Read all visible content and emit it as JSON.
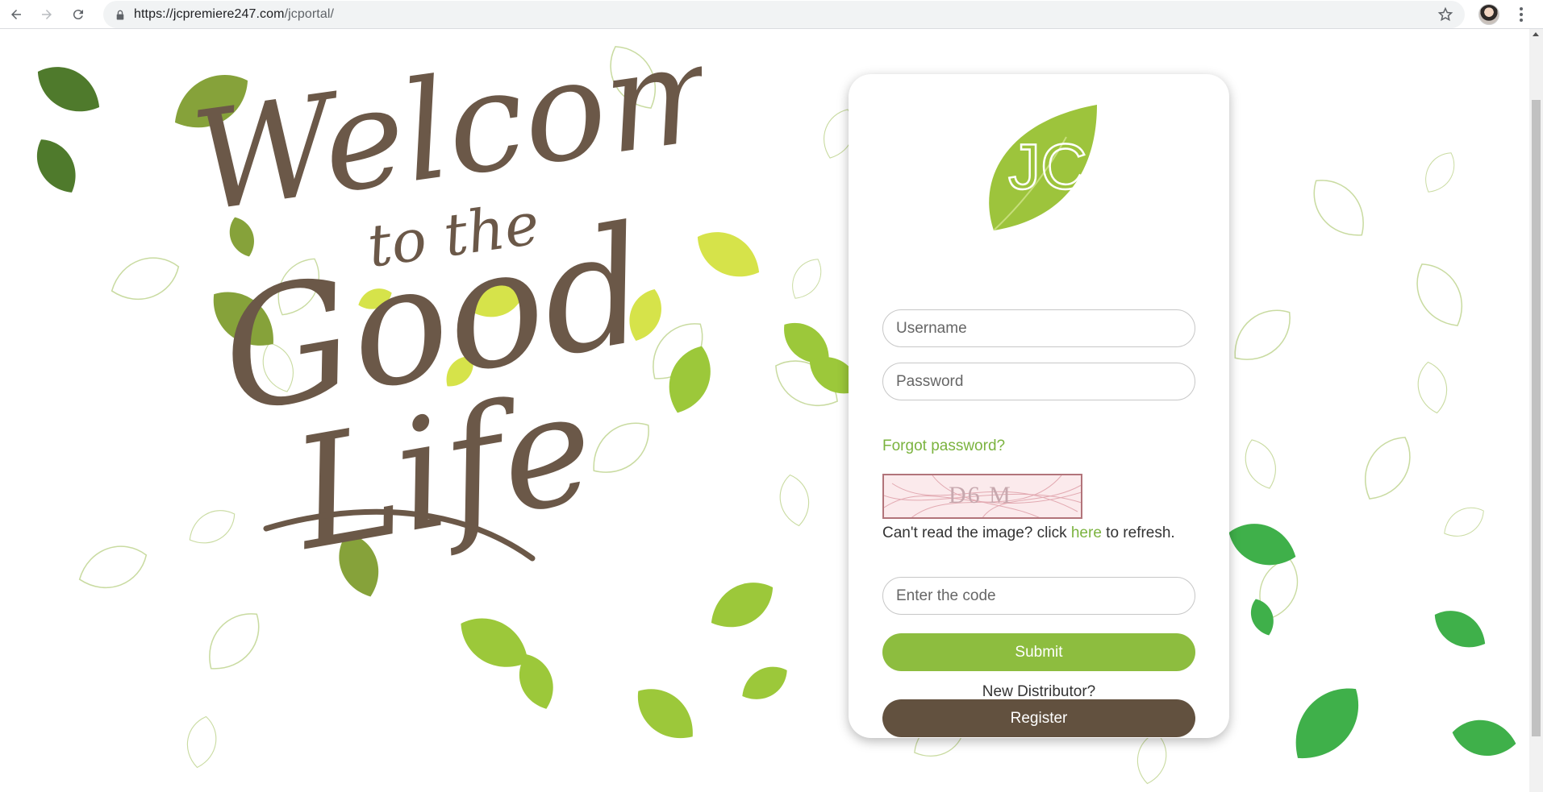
{
  "browser": {
    "url_host": "https://jcpremiere247.com",
    "url_path": "/jcportal/"
  },
  "hero": {
    "line1": "Welcome",
    "line2": "to the",
    "line3": "Good",
    "line4": "Life"
  },
  "login": {
    "logo_text": "JC",
    "username_placeholder": "Username",
    "password_placeholder": "Password",
    "forgot_label": "Forgot password?",
    "captcha_text": "D6 M",
    "refresh_prefix": "Can't read the image? click ",
    "refresh_link": "here",
    "refresh_suffix": " to refresh.",
    "code_placeholder": "Enter the code",
    "submit_label": "Submit",
    "new_distributor_label": "New Distributor?",
    "register_label": "Register"
  },
  "colors": {
    "brand_green": "#8dbd3f",
    "brand_brown": "#62513f",
    "link_green": "#7bb33f"
  }
}
